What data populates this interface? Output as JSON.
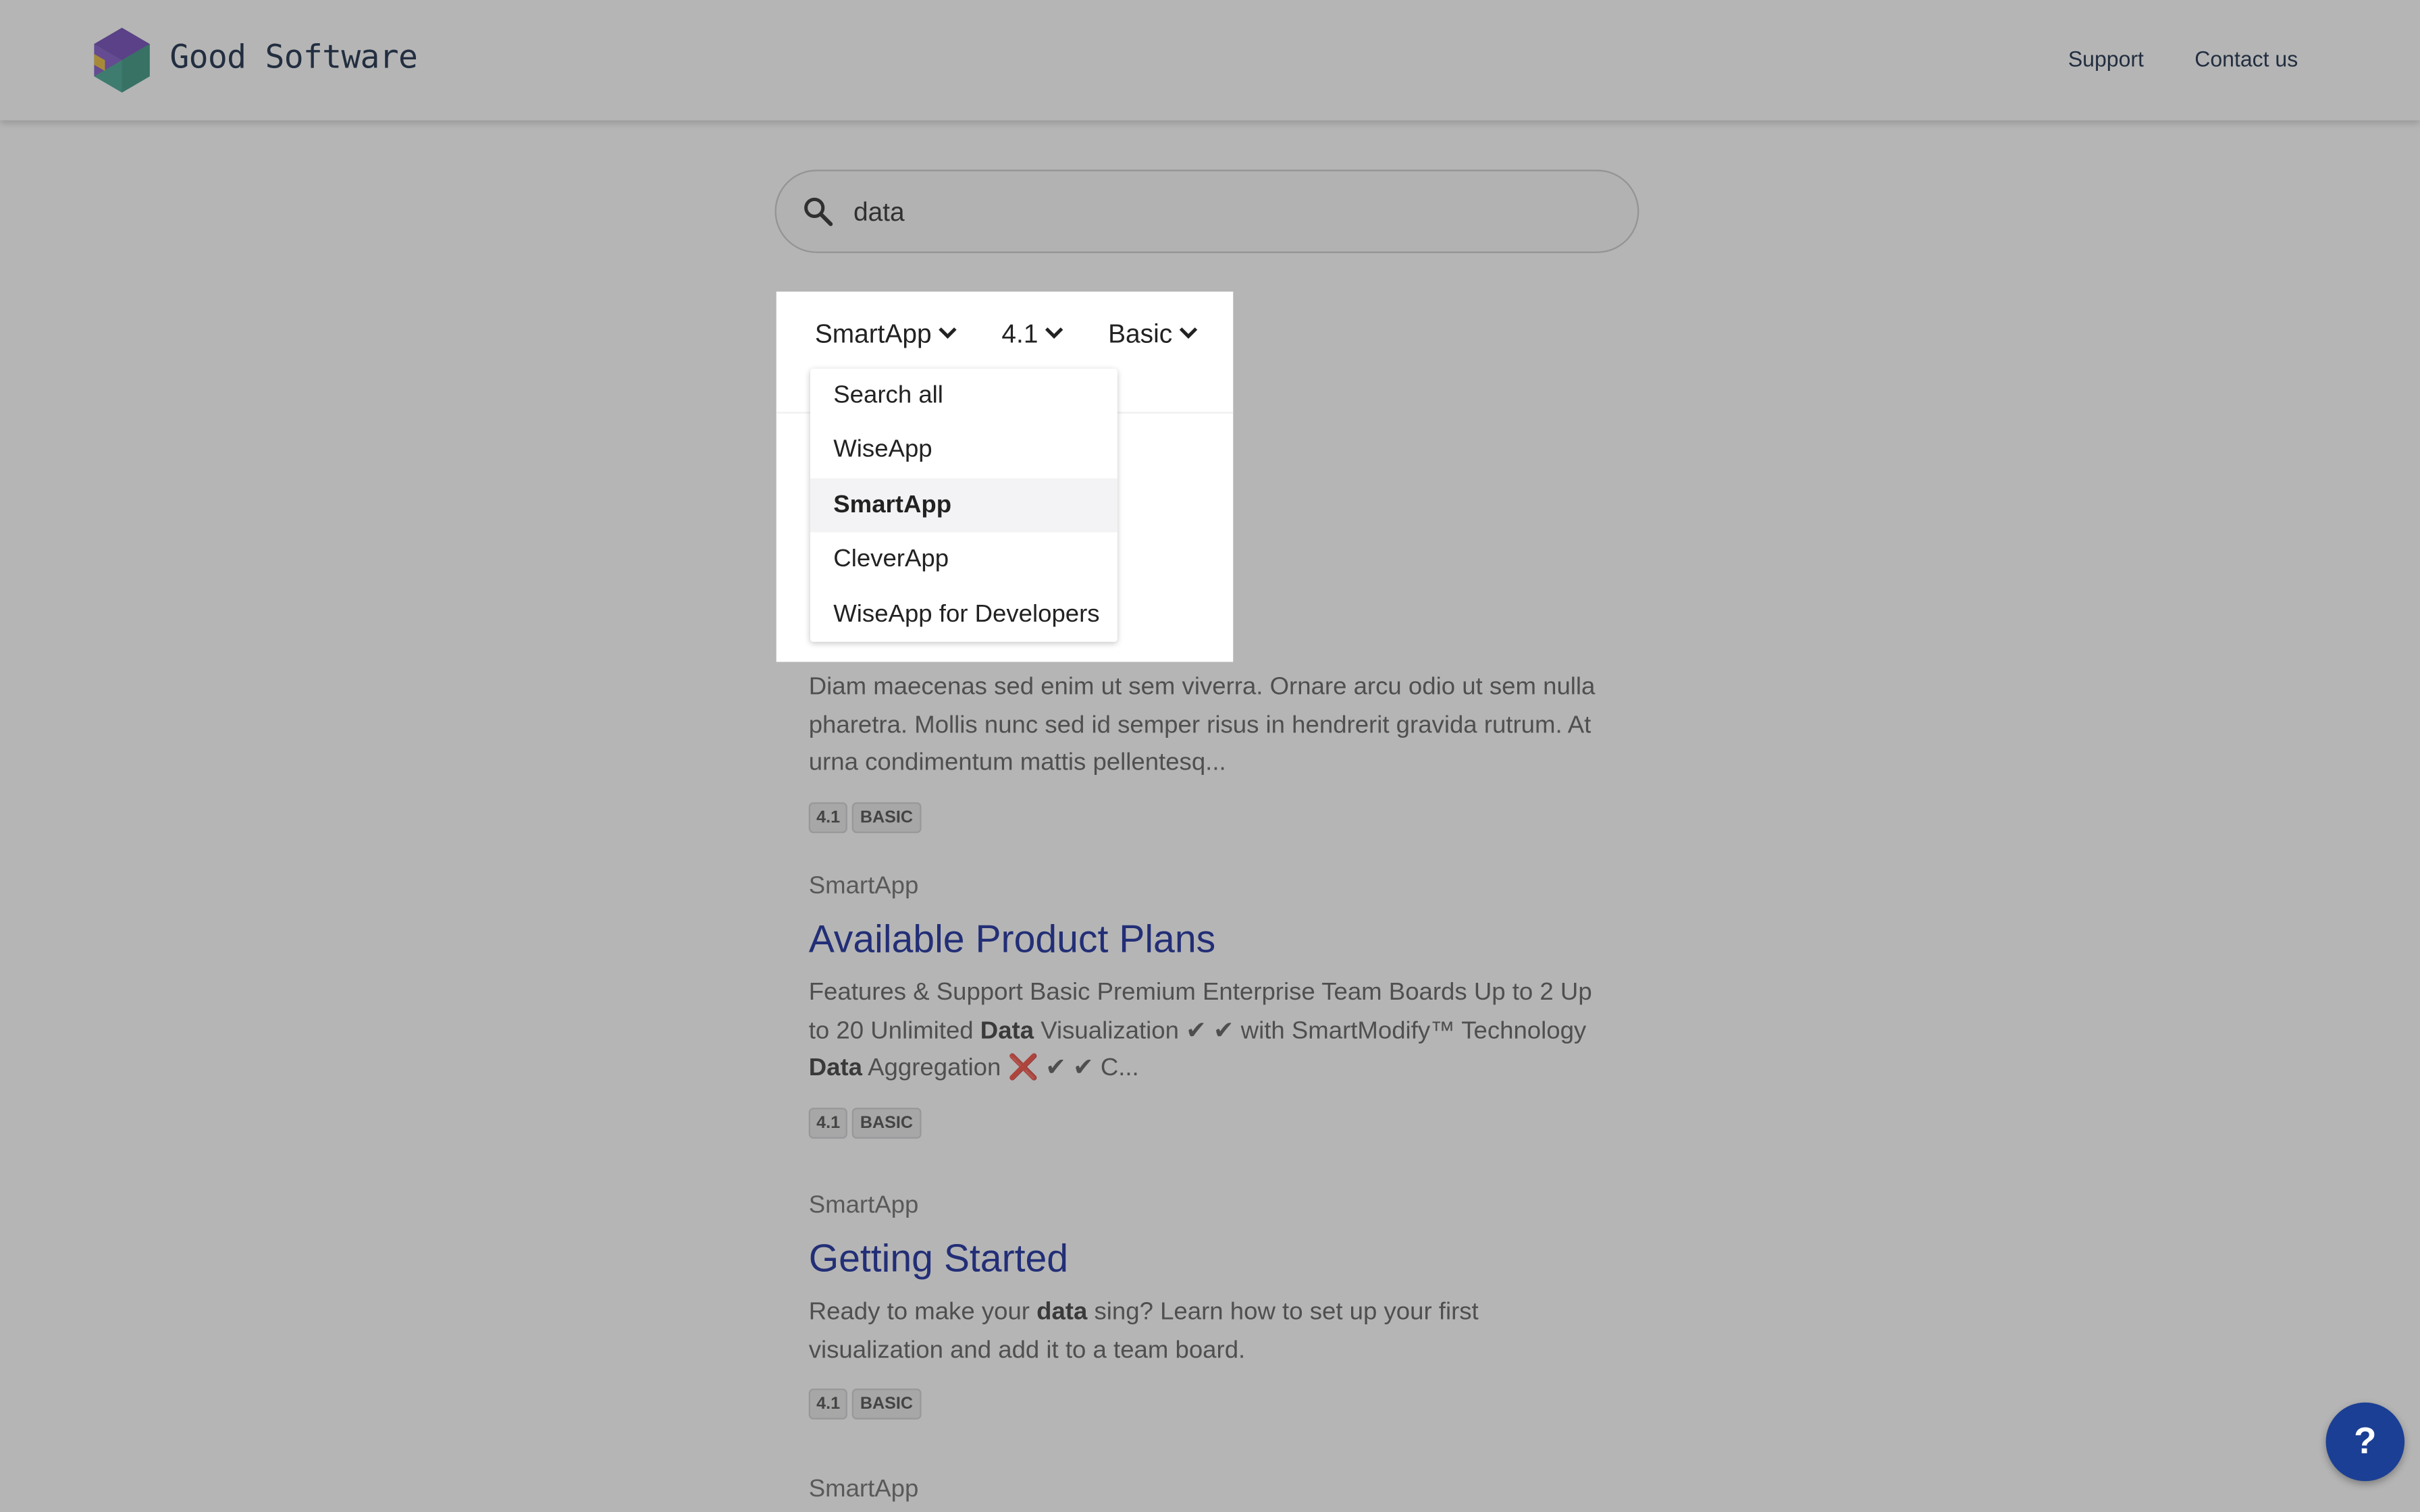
{
  "header": {
    "brand": "Good Software",
    "nav": {
      "support": "Support",
      "contact": "Contact us"
    }
  },
  "search": {
    "query": "data",
    "icon": "search-icon"
  },
  "filters": {
    "product": "SmartApp",
    "version": "4.1",
    "tier": "Basic"
  },
  "product_dropdown": {
    "items": [
      "Search all",
      "WiseApp",
      "SmartApp",
      "CleverApp",
      "WiseApp for Developers"
    ],
    "selected": "SmartApp"
  },
  "results": [
    {
      "snippet_parts": [
        "Diam maecenas sed enim ut sem viverra. Ornare arcu odio ut sem nulla pharetra. Mollis nunc sed id semper risus in hendrerit gravida rutrum. At urna condimentum mattis pellentesq..."
      ],
      "tags": [
        "4.1",
        "BASIC"
      ]
    },
    {
      "product": "SmartApp",
      "title": "Available Product Plans",
      "snippet_parts": [
        "Features & Support Basic Premium Enterprise Team Boards Up to 2 Up to 20 Unlimited ",
        "Data",
        " Visualization ✔ ✔ with SmartModify™ Technology ",
        "Data",
        " Aggregation ",
        "❌",
        " ✔ ✔ C..."
      ],
      "tags": [
        "4.1",
        "BASIC"
      ]
    },
    {
      "product": "SmartApp",
      "title": "Getting Started",
      "snippet_parts": [
        "Ready to make your ",
        "data",
        " sing? Learn how to set up your first visualization and add it to a team board."
      ],
      "tags": [
        "4.1",
        "BASIC"
      ]
    },
    {
      "product": "SmartApp"
    }
  ],
  "help_button": {
    "label": "?"
  },
  "colors": {
    "brand_navy": "#0a1e3c",
    "link_blue": "#0a1e96",
    "help_blue": "#1b3f94",
    "logo_purple": "#6a3fb2",
    "logo_teal": "#3aa08a",
    "logo_yellow": "#e8b830"
  }
}
